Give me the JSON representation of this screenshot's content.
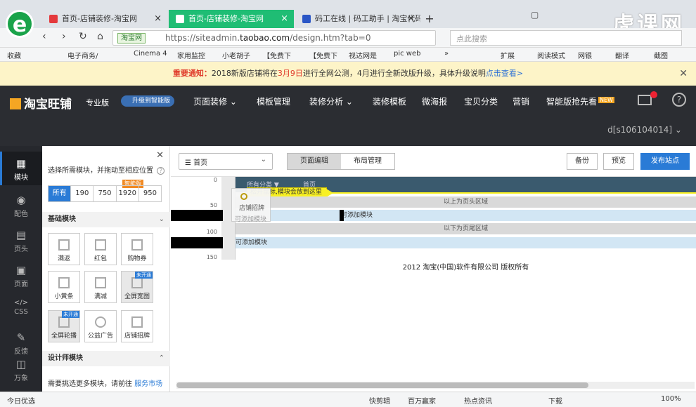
{
  "browser": {
    "tabs": [
      {
        "label": "首页-店铺装修-淘宝网",
        "active": false
      },
      {
        "label": "首页-店铺装修-淘宝网",
        "active": true
      },
      {
        "label": "码工在线 | 码工助手 | 淘宝代码",
        "active": false
      }
    ],
    "new_tab": "+",
    "brand": "虎课网",
    "url_badge": "淘宝网",
    "url_prefix": "https://siteadmin.",
    "url_host": "taobao.com",
    "url_path": "/design.htm?tab=0",
    "search_placeholder": "点此搜索",
    "bookmarks": [
      "收藏",
      "电子商务/",
      "Cinema 4",
      "家用监控",
      "小老胡子",
      "【免费下",
      "【免费下",
      "视达网是",
      "pic web",
      "»",
      "扩展",
      "阅读模式",
      "网银",
      "翻译",
      "截图"
    ]
  },
  "notice": {
    "label": "重要通知：",
    "text1": "2018新版店铺将在",
    "date": "3月9日",
    "text2": "进行全网公测，4月进行全新改版升级，具体升级说明",
    "link": "点击查看>",
    "close": "✕"
  },
  "topnav": {
    "logo": "淘宝旺铺",
    "edition": "专业版",
    "upgrade": "升级到智能版",
    "items": [
      "页面装修 ⌄",
      "模板管理",
      "装修分析 ⌄",
      "装修模板",
      "微海报",
      "宝贝分类",
      "营销",
      "智能版抢先看"
    ],
    "new_badge": "NEW",
    "mail_count": "0",
    "help": "?",
    "user": "d[s106104014] ⌄"
  },
  "sidebar": {
    "items": [
      {
        "label": "模块",
        "glyph": "▦"
      },
      {
        "label": "配色",
        "glyph": "◉"
      },
      {
        "label": "页头",
        "glyph": "▤"
      },
      {
        "label": "页面",
        "glyph": "▣"
      },
      {
        "label": "CSS",
        "glyph": "</>"
      },
      {
        "label": "反馈",
        "glyph": "✎"
      },
      {
        "label": "万象",
        "glyph": "◫"
      }
    ]
  },
  "panel": {
    "close": "✕",
    "tip": "选择所需模块，并拖动至相应位置",
    "width_tabs": [
      "所有",
      "190",
      "750",
      "1920",
      "950"
    ],
    "width_badge": "智能版",
    "basic_section": "基础模块",
    "modules": [
      {
        "label": "满返",
        "tag": ""
      },
      {
        "label": "红包",
        "tag": ""
      },
      {
        "label": "购物券",
        "tag": ""
      },
      {
        "label": "小黄条",
        "tag": ""
      },
      {
        "label": "满减",
        "tag": ""
      },
      {
        "label": "全屏宽图",
        "tag": "未开通"
      },
      {
        "label": "全屏轮播",
        "tag": "未开通"
      },
      {
        "label": "公益广告",
        "tag": ""
      },
      {
        "label": "店铺招牌",
        "tag": ""
      }
    ],
    "designer_section": "设计师模块",
    "bottom_text": "需要挑选更多模块，请前往",
    "bottom_link": "服务市场"
  },
  "workspace": {
    "page_select": "首页",
    "seg": [
      "页面编辑",
      "布局管理"
    ],
    "buttons": {
      "backup": "备份",
      "preview": "预览",
      "publish": "发布站点"
    },
    "ruler": [
      "0",
      "50",
      "100",
      "150"
    ],
    "header_tabs": [
      "所有分类 ▼",
      "首页"
    ],
    "drag_tip": "松开鼠标,模块会放到这里",
    "ghost_label": "店铺招牌",
    "ghost_sub": "可添加模块",
    "zone_header": "以上为页头区域",
    "zone_add1": "可添加模块",
    "zone_footer": "以下为页尾区域",
    "zone_add2": "可添加模块",
    "copyright": "2012 淘宝(中国)软件有限公司 版权所有"
  },
  "statusbar": [
    "今日优选",
    "快剪辑",
    "百万赢家",
    "热点资讯",
    "下载",
    "100%"
  ]
}
